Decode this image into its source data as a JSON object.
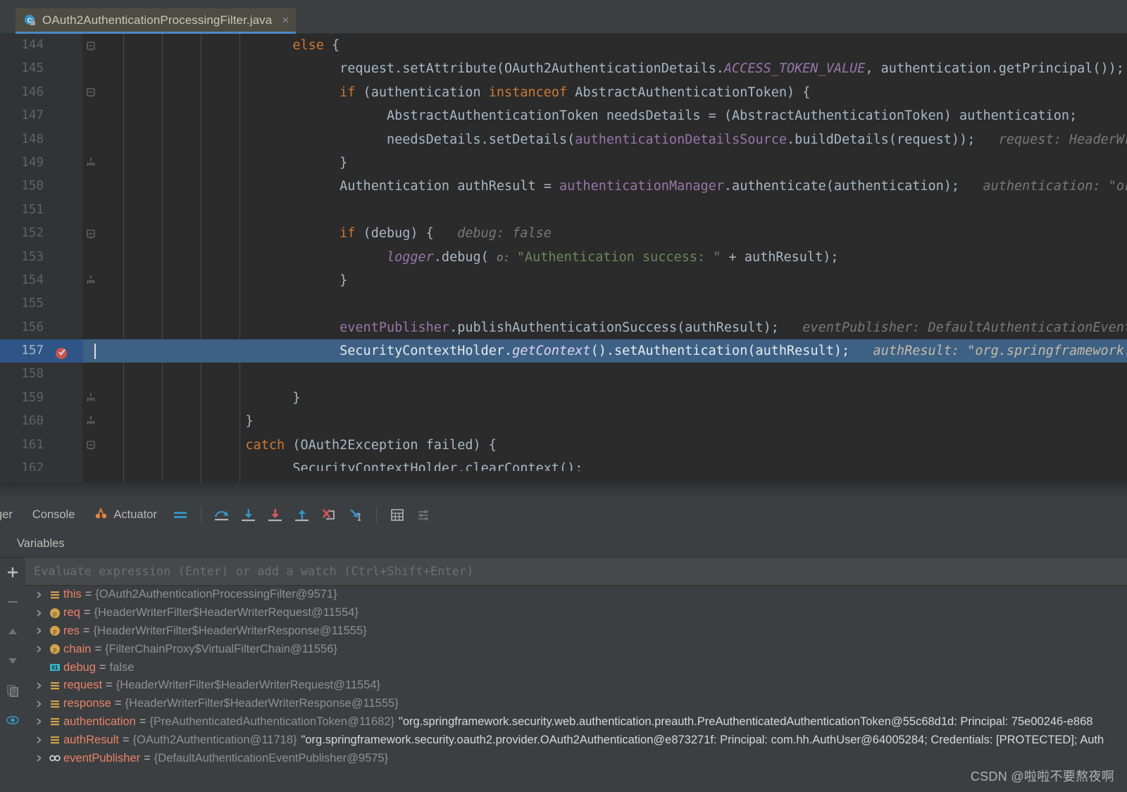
{
  "window": {
    "app": "IntelliJ IDEA Debugger"
  },
  "tabbar": {
    "tab_label": "OAuth2AuthenticationProcessingFilter.java",
    "tab_icon": "java-class-locked-icon",
    "close_label": "×"
  },
  "editor": {
    "first_line": 144,
    "execution_line": 157,
    "lines": [
      {
        "no": "144",
        "fold": "minus",
        "indent": 24,
        "tokens": [
          {
            "t": "else",
            "c": "kw"
          },
          {
            "t": " {",
            "c": "ident"
          }
        ]
      },
      {
        "no": "145",
        "fold": "",
        "indent": 30,
        "tokens": [
          {
            "t": "request.setAttribute(OAuth2AuthenticationDetails.",
            "c": "ident"
          },
          {
            "t": "ACCESS_TOKEN_VALUE",
            "c": "stat"
          },
          {
            "t": ", authentication.getPrincipal());",
            "c": "ident"
          }
        ]
      },
      {
        "no": "146",
        "fold": "minus",
        "indent": 30,
        "tokens": [
          {
            "t": "if",
            "c": "kw"
          },
          {
            "t": " (authentication ",
            "c": "ident"
          },
          {
            "t": "instanceof",
            "c": "kw"
          },
          {
            "t": " AbstractAuthenticationToken) {",
            "c": "ident"
          }
        ]
      },
      {
        "no": "147",
        "fold": "",
        "indent": 36,
        "tokens": [
          {
            "t": "AbstractAuthenticationToken needsDetails = (AbstractAuthenticationToken) authentication;",
            "c": "ident"
          }
        ]
      },
      {
        "no": "148",
        "fold": "",
        "indent": 36,
        "tokens": [
          {
            "t": "needsDetails.setDetails(",
            "c": "ident"
          },
          {
            "t": "authenticationDetailsSource",
            "c": "field"
          },
          {
            "t": ".buildDetails(request));",
            "c": "ident"
          },
          {
            "t": "   request: HeaderWriterFilter",
            "c": "hint"
          }
        ]
      },
      {
        "no": "149",
        "fold": "plus-end",
        "indent": 30,
        "tokens": [
          {
            "t": "}",
            "c": "ident"
          }
        ]
      },
      {
        "no": "150",
        "fold": "",
        "indent": 30,
        "tokens": [
          {
            "t": "Authentication authResult = ",
            "c": "ident"
          },
          {
            "t": "authenticationManager",
            "c": "field"
          },
          {
            "t": ".authenticate(authentication);",
            "c": "ident"
          },
          {
            "t": "   authentication: \"org.spring",
            "c": "hint"
          }
        ]
      },
      {
        "no": "151",
        "fold": "",
        "indent": 30,
        "tokens": []
      },
      {
        "no": "152",
        "fold": "minus",
        "indent": 30,
        "tokens": [
          {
            "t": "if",
            "c": "kw"
          },
          {
            "t": " (debug) {",
            "c": "ident"
          },
          {
            "t": "   debug: false",
            "c": "hint"
          }
        ]
      },
      {
        "no": "153",
        "fold": "",
        "indent": 36,
        "tokens": [
          {
            "t": "logger",
            "c": "stat"
          },
          {
            "t": ".debug( ",
            "c": "ident"
          },
          {
            "t": "o: ",
            "c": "phint"
          },
          {
            "t": "\"Authentication success: \"",
            "c": "str"
          },
          {
            "t": " + authResult);",
            "c": "ident"
          }
        ]
      },
      {
        "no": "154",
        "fold": "plus-end",
        "indent": 30,
        "tokens": [
          {
            "t": "}",
            "c": "ident"
          }
        ]
      },
      {
        "no": "155",
        "fold": "",
        "indent": 30,
        "tokens": []
      },
      {
        "no": "156",
        "fold": "",
        "indent": 30,
        "tokens": [
          {
            "t": "eventPublisher",
            "c": "field"
          },
          {
            "t": ".publishAuthenticationSuccess(authResult);",
            "c": "ident"
          },
          {
            "t": "   eventPublisher: DefaultAuthenticationEventPublish",
            "c": "hint"
          }
        ]
      },
      {
        "no": "157",
        "fold": "",
        "indent": 30,
        "exec": true,
        "breakpoint": true,
        "tokens": [
          {
            "t": "SecurityContextHolder.",
            "c": "ident"
          },
          {
            "t": "getContext",
            "c": "stat"
          },
          {
            "t": "().setAuthentication(authResult);",
            "c": "ident"
          },
          {
            "t": "   authResult: \"org.springframework.securit",
            "c": "hint"
          }
        ]
      },
      {
        "no": "158",
        "fold": "",
        "indent": 30,
        "tokens": []
      },
      {
        "no": "159",
        "fold": "plus-end",
        "indent": 24,
        "tokens": [
          {
            "t": "}",
            "c": "ident"
          }
        ]
      },
      {
        "no": "160",
        "fold": "plus-end",
        "indent": 18,
        "tokens": [
          {
            "t": "}",
            "c": "ident"
          }
        ]
      },
      {
        "no": "161",
        "fold": "minus",
        "indent": 18,
        "tokens": [
          {
            "t": "catch",
            "c": "kw"
          },
          {
            "t": " (OAuth2Exception failed) {",
            "c": "ident"
          }
        ]
      },
      {
        "no": "162",
        "fold": "",
        "indent": 24,
        "clipped": true,
        "tokens": [
          {
            "t": "SecurityContextHolder.clearContext();",
            "c": "ident"
          }
        ]
      }
    ]
  },
  "debug_toolbar": {
    "tab_debugger_partial": "ger",
    "tab_console": "Console",
    "tab_actuator": "Actuator",
    "actuator_icon": "actuator-icon",
    "buttons": [
      {
        "name": "show-execution-point-button",
        "icon": "equals-icon",
        "label": "Show Execution Point"
      },
      {
        "name": "step-over-button",
        "icon": "step-over-icon",
        "label": "Step Over"
      },
      {
        "name": "step-into-button",
        "icon": "step-into-icon",
        "label": "Step Into"
      },
      {
        "name": "force-step-into-button",
        "icon": "force-step-into-icon",
        "label": "Force Step Into"
      },
      {
        "name": "step-out-button",
        "icon": "step-out-icon",
        "label": "Step Out"
      },
      {
        "name": "drop-frame-button",
        "icon": "drop-frame-icon",
        "label": "Drop Frame"
      },
      {
        "name": "run-to-cursor-button",
        "icon": "run-to-cursor-icon",
        "label": "Run to Cursor"
      },
      {
        "name": "evaluate-expression-button",
        "icon": "calculator-icon",
        "label": "Evaluate Expression"
      },
      {
        "name": "settings-button",
        "icon": "sliders-icon",
        "label": "Layout Settings"
      }
    ]
  },
  "variables_panel": {
    "tab_label": "Variables",
    "evaluate_placeholder": "Evaluate expression (Enter) or add a watch (Ctrl+Shift+Enter)",
    "rail_buttons": [
      {
        "name": "add-watch-button",
        "icon": "plus-icon",
        "label": "+"
      },
      {
        "name": "remove-watch-button",
        "icon": "minus-icon",
        "label": "−"
      },
      {
        "name": "move-up-button",
        "icon": "triangle-up-icon",
        "label": "▲"
      },
      {
        "name": "move-down-button",
        "icon": "triangle-down-icon",
        "label": "▼"
      },
      {
        "name": "copy-value-button",
        "icon": "copy-icon",
        "label": "copy"
      },
      {
        "name": "inspect-button",
        "icon": "eye-icon",
        "label": "inspect"
      }
    ],
    "rows": [
      {
        "expandable": true,
        "icon": "object-field-icon",
        "name": "this",
        "eq": "=",
        "value": "{OAuth2AuthenticationProcessingFilter@9571}",
        "tostring": ""
      },
      {
        "expandable": true,
        "icon": "parameter-icon",
        "name": "req",
        "eq": "=",
        "value": "{HeaderWriterFilter$HeaderWriterRequest@11554}",
        "tostring": ""
      },
      {
        "expandable": true,
        "icon": "parameter-icon",
        "name": "res",
        "eq": "=",
        "value": "{HeaderWriterFilter$HeaderWriterResponse@11555}",
        "tostring": ""
      },
      {
        "expandable": true,
        "icon": "parameter-icon",
        "name": "chain",
        "eq": "=",
        "value": "{FilterChainProxy$VirtualFilterChain@11556}",
        "tostring": ""
      },
      {
        "expandable": false,
        "icon": "primitive-icon",
        "name": "debug",
        "eq": "=",
        "value": "false",
        "tostring": ""
      },
      {
        "expandable": true,
        "icon": "object-field-icon",
        "name": "request",
        "eq": "=",
        "value": "{HeaderWriterFilter$HeaderWriterRequest@11554}",
        "tostring": ""
      },
      {
        "expandable": true,
        "icon": "object-field-icon",
        "name": "response",
        "eq": "=",
        "value": "{HeaderWriterFilter$HeaderWriterResponse@11555}",
        "tostring": ""
      },
      {
        "expandable": true,
        "icon": "object-field-icon",
        "name": "authentication",
        "eq": "=",
        "value": "{PreAuthenticatedAuthenticationToken@11682}",
        "tostring": "\"org.springframework.security.web.authentication.preauth.PreAuthenticatedAuthenticationToken@55c68d1d: Principal: 75e00246-e868"
      },
      {
        "expandable": true,
        "icon": "object-field-icon",
        "name": "authResult",
        "eq": "=",
        "value": "{OAuth2Authentication@11718}",
        "tostring": "\"org.springframework.security.oauth2.provider.OAuth2Authentication@e873271f: Principal: com.hh.AuthUser@64005284; Credentials: [PROTECTED]; Auth"
      },
      {
        "expandable": true,
        "icon": "watch-icon",
        "name": "eventPublisher",
        "eq": "=",
        "value": "{DefaultAuthenticationEventPublisher@9575}",
        "tostring": ""
      }
    ]
  },
  "watermark": {
    "text": "CSDN @啦啦不要熬夜啊"
  },
  "colors": {
    "editor_bg": "#2b2b2b",
    "gutter_bg": "#313335",
    "panel_bg": "#3c3f41",
    "exec_line_bg": "#2f5586",
    "tab_underline": "#4a88c7",
    "keyword": "#cc7832",
    "field": "#9876aa",
    "string": "#6a8759",
    "var_name": "#e8836a",
    "breakpoint": "#c75450"
  }
}
